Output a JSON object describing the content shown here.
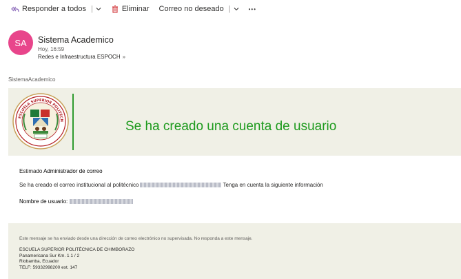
{
  "toolbar": {
    "reply_all": "Responder a todos",
    "delete": "Eliminar",
    "junk": "Correo no deseado",
    "more": "•••"
  },
  "message": {
    "avatar_initials": "SA",
    "sender": "Sistema Academico",
    "date": "Hoy, 16:59",
    "to": "Redes e Infraestructura ESPOCH",
    "from_label": "SistemaAcademico"
  },
  "banner": {
    "title": "Se ha creado una cuenta de usuario"
  },
  "body": {
    "greeting_prefix": "Estimado",
    "greeting_role": "Administrador de correo",
    "line2_prefix": "Se ha creado el correo institucional al politécnico",
    "line2_suffix": "Tenga en cuenta la siguiente información",
    "username_label": "Nombre de usuario:"
  },
  "footer": {
    "notice": "Este mensaje se ha enviado desde una dirección de correo electrónico no supervisada. No responda a este mensaje.",
    "org": "ESCUELA SUPERIOR POLITÉCNICA DE CHIMBORAZO",
    "address1": "Panamericana Sur Km. 1 1 / 2",
    "address2": "Riobamba, Ecuador",
    "phone": "TELF: 59332998200 ext. 147"
  },
  "colors": {
    "accent_green": "#1d9a1d",
    "avatar_pink": "#e8458b",
    "delete_red": "#d13438",
    "reply_purple": "#8764b8",
    "banner_bg": "#f0f0e6"
  }
}
